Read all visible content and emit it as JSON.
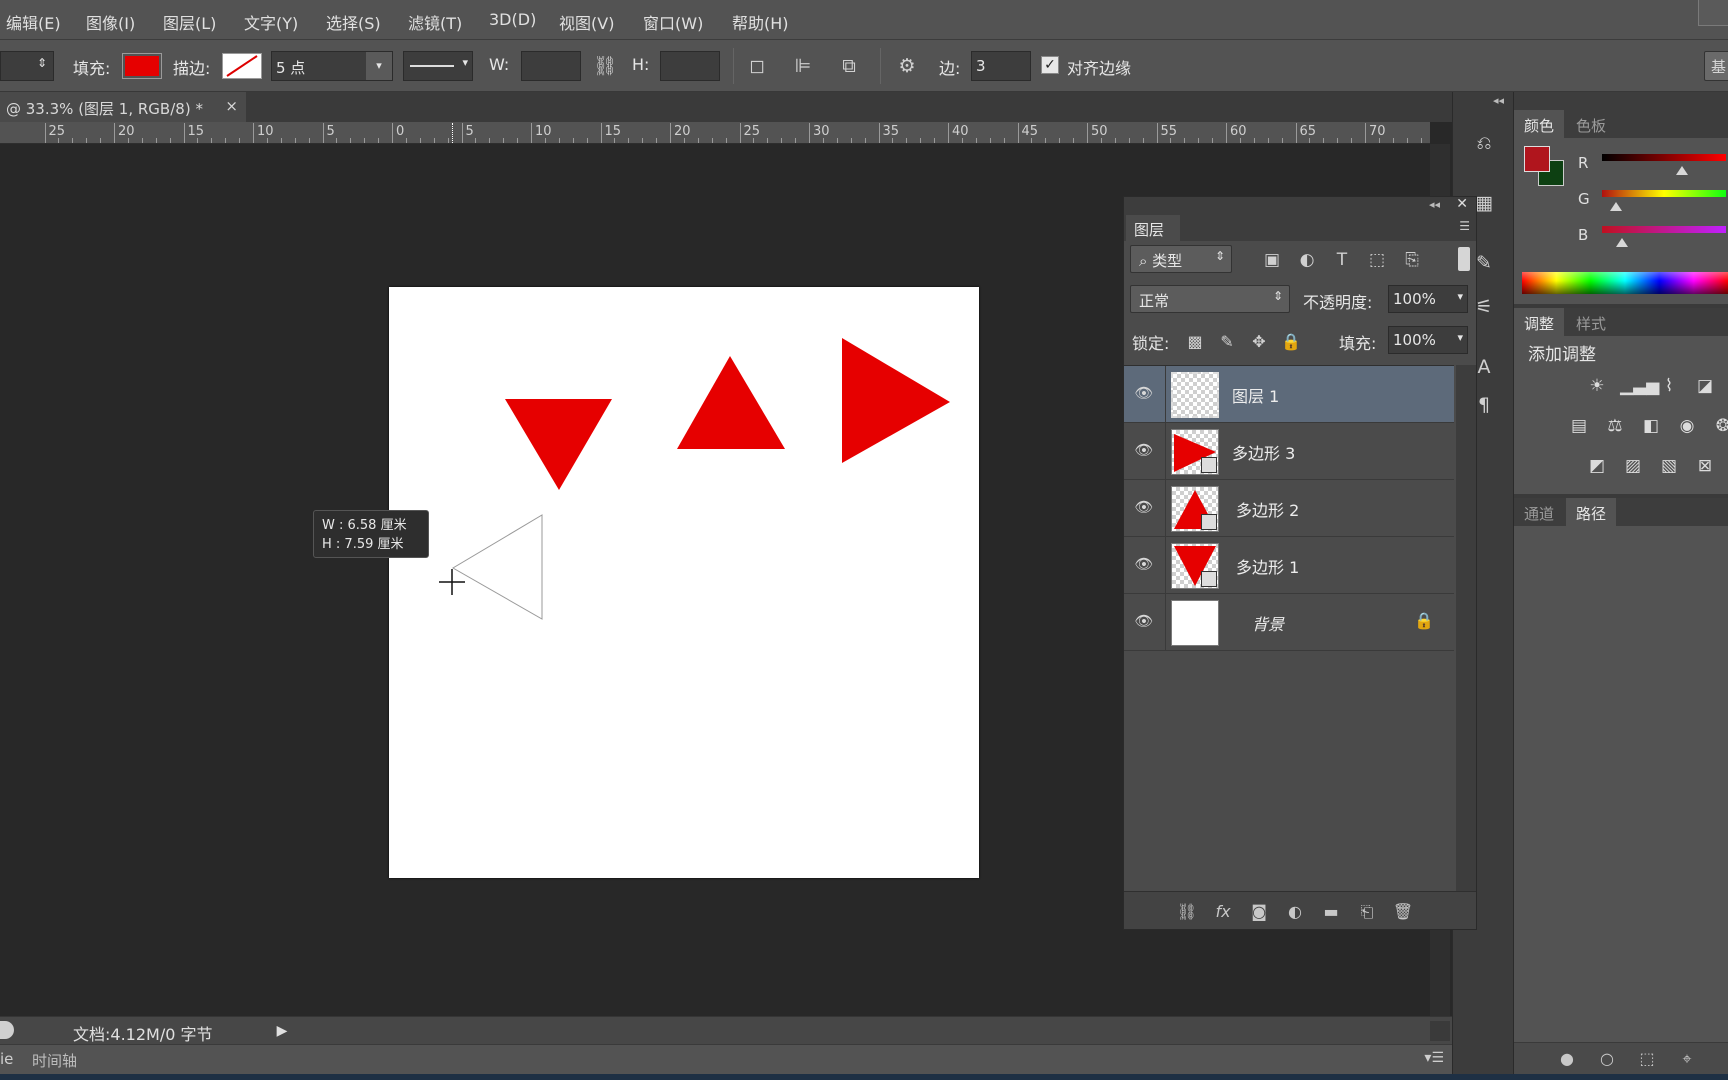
{
  "menu": [
    "编辑(E)",
    "图像(I)",
    "图层(L)",
    "文字(Y)",
    "选择(S)",
    "滤镜(T)",
    "3D(D)",
    "视图(V)",
    "窗口(W)",
    "帮助(H)"
  ],
  "options": {
    "fill_label": "填充:",
    "fill_color": "#e60000",
    "stroke_label": "描边:",
    "stroke_width": "5 点",
    "w_label": "W:",
    "w_value": "",
    "h_label": "H:",
    "h_value": "",
    "sides_label": "边:",
    "sides_value": "3",
    "align_edges_label": "对齐边缘",
    "align_edges_checked": true,
    "workspace_btn": "基"
  },
  "document": {
    "tab_title": "@ 33.3% (图层 1, RGB/8) *",
    "close": "×",
    "shape_color": "#e60000"
  },
  "ruler_labels": [
    "25",
    "20",
    "15",
    "10",
    "5",
    "0",
    "5",
    "10",
    "15",
    "20",
    "25",
    "30",
    "35",
    "40",
    "45",
    "50",
    "55",
    "60",
    "65",
    "70"
  ],
  "hud": {
    "w": "W : 6.58 厘米",
    "h": "H : 7.59 厘米"
  },
  "status": {
    "doc_info": "文档:4.12M/0 字节",
    "timeline_tab": "时间轴",
    "left_tab": "ie"
  },
  "layers_panel": {
    "tab": "图层",
    "filter_label": "类型",
    "blend_mode": "正常",
    "opacity_label": "不透明度:",
    "opacity_value": "100%",
    "lock_label": "锁定:",
    "fill_label": "填充:",
    "fill_value": "100%",
    "layers": [
      {
        "name": "图层 1",
        "selected": true,
        "thumb": "transparent"
      },
      {
        "name": "多边形 3",
        "selected": false,
        "thumb": "triangle-right"
      },
      {
        "name": "多边形 2",
        "selected": false,
        "thumb": "triangle-up"
      },
      {
        "name": "多边形 1",
        "selected": false,
        "thumb": "triangle-down"
      },
      {
        "name": "背景",
        "selected": false,
        "thumb": "white",
        "locked": true
      }
    ]
  },
  "color_panel": {
    "tabs": [
      "颜色",
      "色板"
    ],
    "foreground": "#b0151d",
    "background": "#0d4012",
    "r_label": "R",
    "g_label": "G",
    "b_label": "B"
  },
  "adjust_panel": {
    "tabs": [
      "调整",
      "样式"
    ],
    "title": "添加调整"
  },
  "paths_panel": {
    "tabs": [
      "通道",
      "路径"
    ]
  }
}
